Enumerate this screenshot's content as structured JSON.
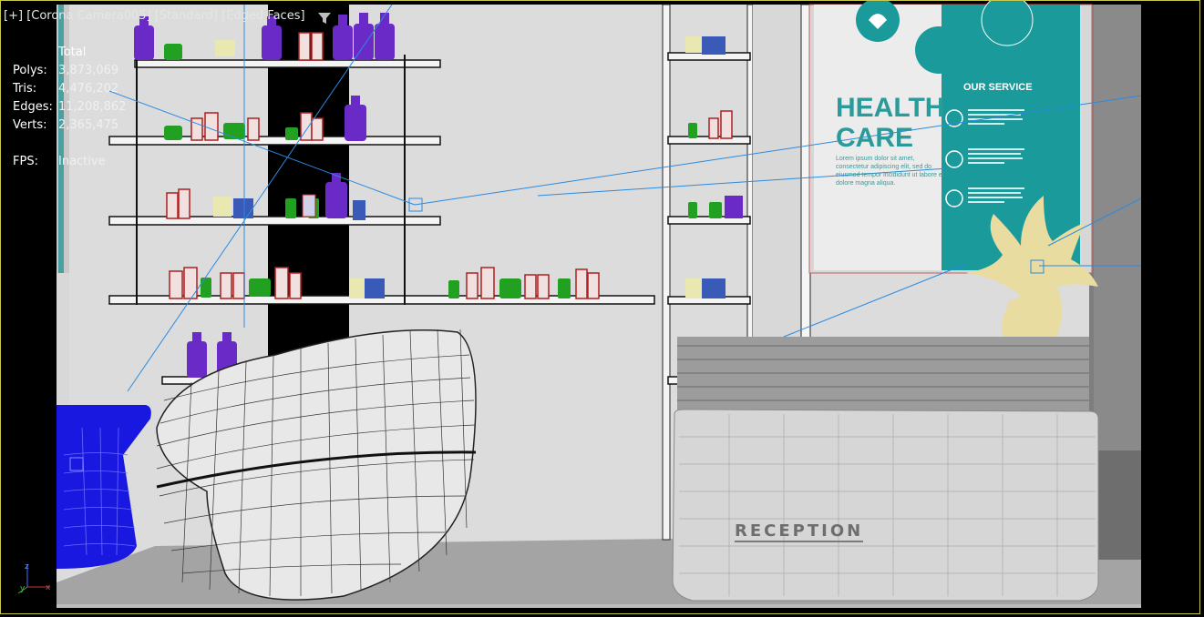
{
  "viewport": {
    "label_parts": [
      "[+]",
      "[Corona Camera005]",
      "[Standard]",
      "[Edged Faces]"
    ],
    "filter_icon": "filter-funnel-icon",
    "axis_icon": "axis-gizmo-icon"
  },
  "stats": {
    "header": "Total",
    "rows": [
      {
        "label": "Polys:",
        "value": "3,873,069"
      },
      {
        "label": "Tris:",
        "value": "4,476,202"
      },
      {
        "label": "Edges:",
        "value": "11,208,862"
      },
      {
        "label": "Verts:",
        "value": "2,365,475"
      },
      {
        "label": "FPS:",
        "value": "Inactive"
      }
    ]
  },
  "scene": {
    "reception_sign": "RECEPTION",
    "poster": {
      "title": "HEALTH\nCARE",
      "service": "OUR SERVICE",
      "lorem": "Lorem ipsum dolor sit amet, consectetur adipiscing elit, sed do eiusmod tempor incididunt ut labore et dolore magna aliqua."
    },
    "colors": {
      "wall": "#e0e0e0",
      "floor": "#a8a8a8",
      "shelf_column": "#000000",
      "poster_teal": "#1a9a9a",
      "chair_blue": "#1010e0",
      "plant": "#e8dca0",
      "bottle_purple": "#6a2ac8"
    }
  }
}
